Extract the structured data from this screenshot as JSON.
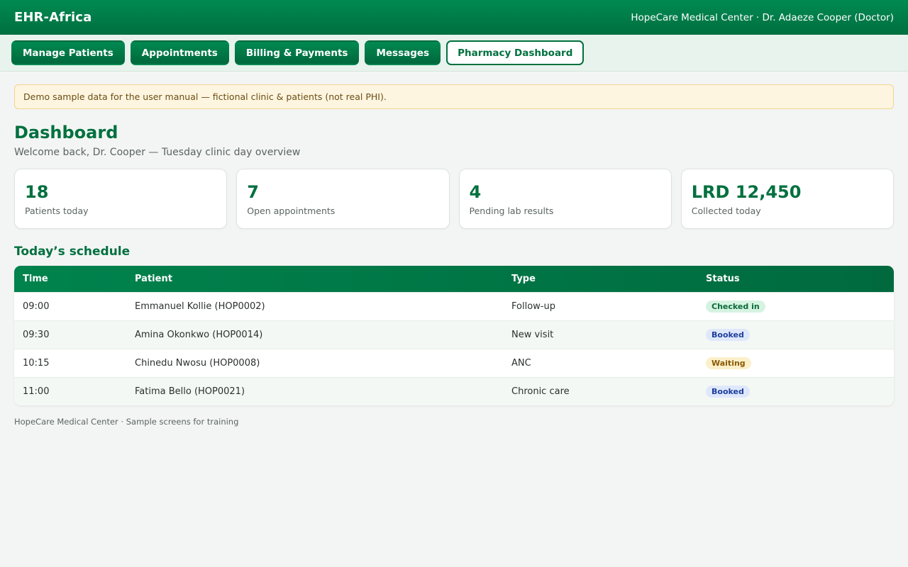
{
  "header": {
    "brand": "EHR-Africa",
    "user_info": "HopeCare Medical Center · Dr. Adaeze Cooper (Doctor)"
  },
  "nav": {
    "items": [
      {
        "label": "Manage Patients"
      },
      {
        "label": "Appointments"
      },
      {
        "label": "Billing & Payments"
      },
      {
        "label": "Messages"
      },
      {
        "label": "Pharmacy Dashboard"
      }
    ]
  },
  "notice": "Demo sample data for the user manual — fictional clinic & patients (not real PHI).",
  "page": {
    "title": "Dashboard",
    "subtitle": "Welcome back, Dr. Cooper — Tuesday clinic day overview"
  },
  "stats": [
    {
      "value": "18",
      "label": "Patients today"
    },
    {
      "value": "7",
      "label": "Open appointments"
    },
    {
      "value": "4",
      "label": "Pending lab results"
    },
    {
      "value": "LRD 12,450",
      "label": "Collected today"
    }
  ],
  "schedule": {
    "title": "Today’s schedule",
    "columns": [
      "Time",
      "Patient",
      "Type",
      "Status"
    ],
    "rows": [
      {
        "time": "09:00",
        "patient": "Emmanuel Kollie (HOP0002)",
        "type": "Follow-up",
        "status": "Checked in"
      },
      {
        "time": "09:30",
        "patient": "Amina Okonkwo (HOP0014)",
        "type": "New visit",
        "status": "Booked"
      },
      {
        "time": "10:15",
        "patient": "Chinedu Nwosu (HOP0008)",
        "type": "ANC",
        "status": "Waiting"
      },
      {
        "time": "11:00",
        "patient": "Fatima Bello (HOP0021)",
        "type": "Chronic care",
        "status": "Booked"
      }
    ]
  },
  "footer": "HopeCare Medical Center · Sample screens for training",
  "colors": {
    "brand_green": "#00703f",
    "status_checked_in": "#d6f3e1",
    "status_booked": "#dfe8fb",
    "status_waiting": "#fbf0c9"
  }
}
